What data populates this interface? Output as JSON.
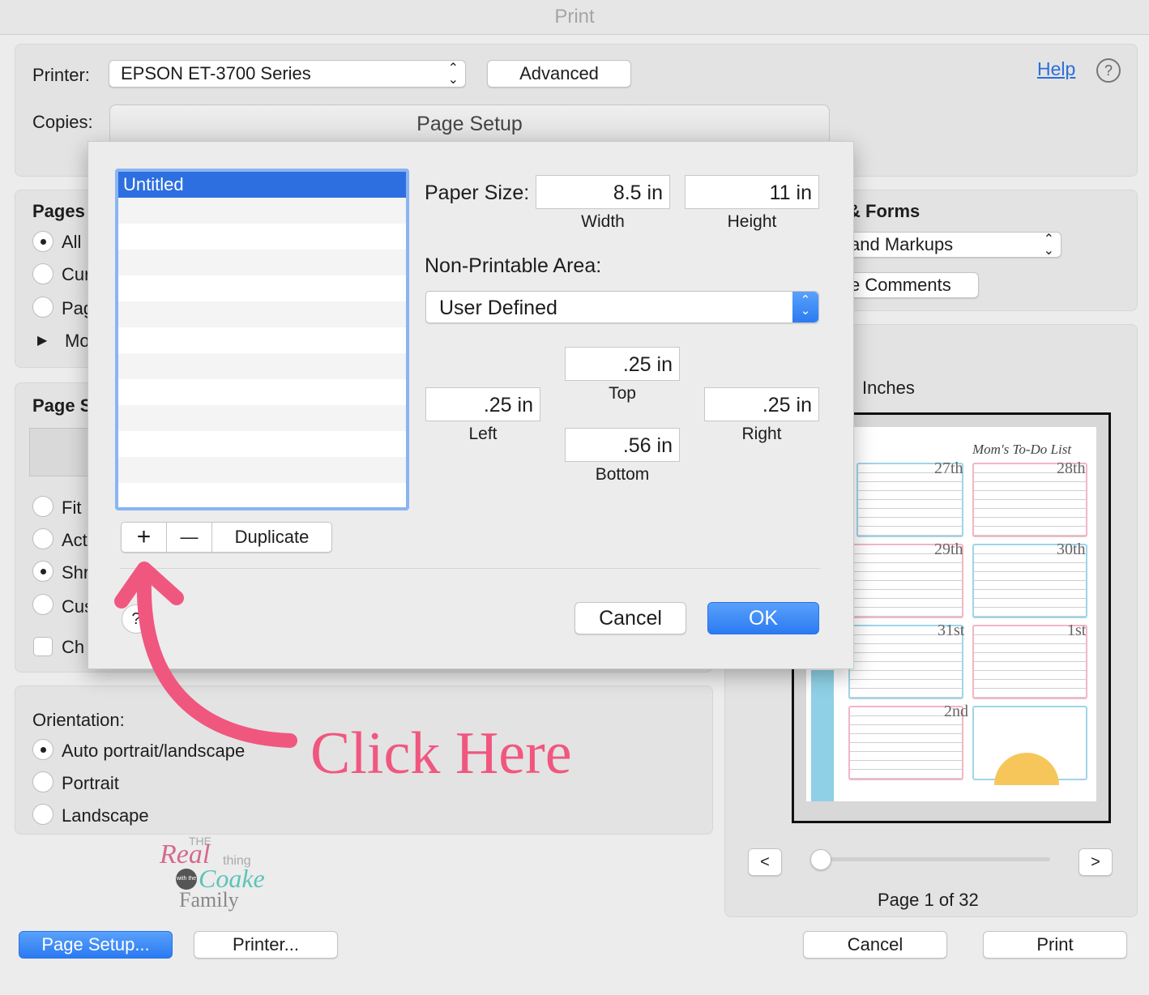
{
  "window": {
    "title": "Print"
  },
  "printer": {
    "label": "Printer:",
    "value": "EPSON ET-3700 Series",
    "advanced": "Advanced",
    "help": "Help"
  },
  "copies": {
    "label": "Copies:"
  },
  "pages": {
    "title": "Pages",
    "options": [
      "All",
      "Cur",
      "Pag"
    ],
    "more": "Mo"
  },
  "page_scaling": {
    "title": "Page S",
    "options": [
      "Fit",
      "Act",
      "Shr",
      "Cus"
    ],
    "check": "Ch"
  },
  "orientation": {
    "title": "Orientation:",
    "options": [
      "Auto portrait/landscape",
      "Portrait",
      "Landscape"
    ]
  },
  "forms": {
    "title": "& Forms",
    "select": "and Markups",
    "button": "e Comments"
  },
  "preview": {
    "units": "Inches",
    "prev": "<",
    "next": ">",
    "page_info": "Page 1 of 32",
    "slider": 0.0
  },
  "preview_page": {
    "title": "Mom's To-Do List",
    "days": [
      "27th",
      "28th",
      "29th",
      "30th",
      "31st",
      "1st",
      "2nd"
    ]
  },
  "footer": {
    "page_setup": "Page Setup...",
    "printer": "Printer...",
    "cancel": "Cancel",
    "print": "Print"
  },
  "page_setup_dialog": {
    "title": "Page Setup",
    "list": [
      "Untitled"
    ],
    "add": "+",
    "remove": "—",
    "duplicate": "Duplicate",
    "help": "?",
    "paper_size_label": "Paper Size:",
    "width": "8.5 in",
    "width_label": "Width",
    "height": "11 in",
    "height_label": "Height",
    "non_printable_label": "Non-Printable Area:",
    "non_printable_value": "User Defined",
    "top": ".25 in",
    "top_label": "Top",
    "left": ".25 in",
    "left_label": "Left",
    "right": ".25 in",
    "right_label": "Right",
    "bottom": ".56 in",
    "bottom_label": "Bottom",
    "cancel": "Cancel",
    "ok": "OK"
  },
  "annotation": {
    "text": "Click Here",
    "color": "#f0577f"
  },
  "watermark": {
    "line1": "THE",
    "line2": "Real",
    "line3": "thing",
    "line4": "with the",
    "line5": "Coake",
    "line6": "Family"
  }
}
